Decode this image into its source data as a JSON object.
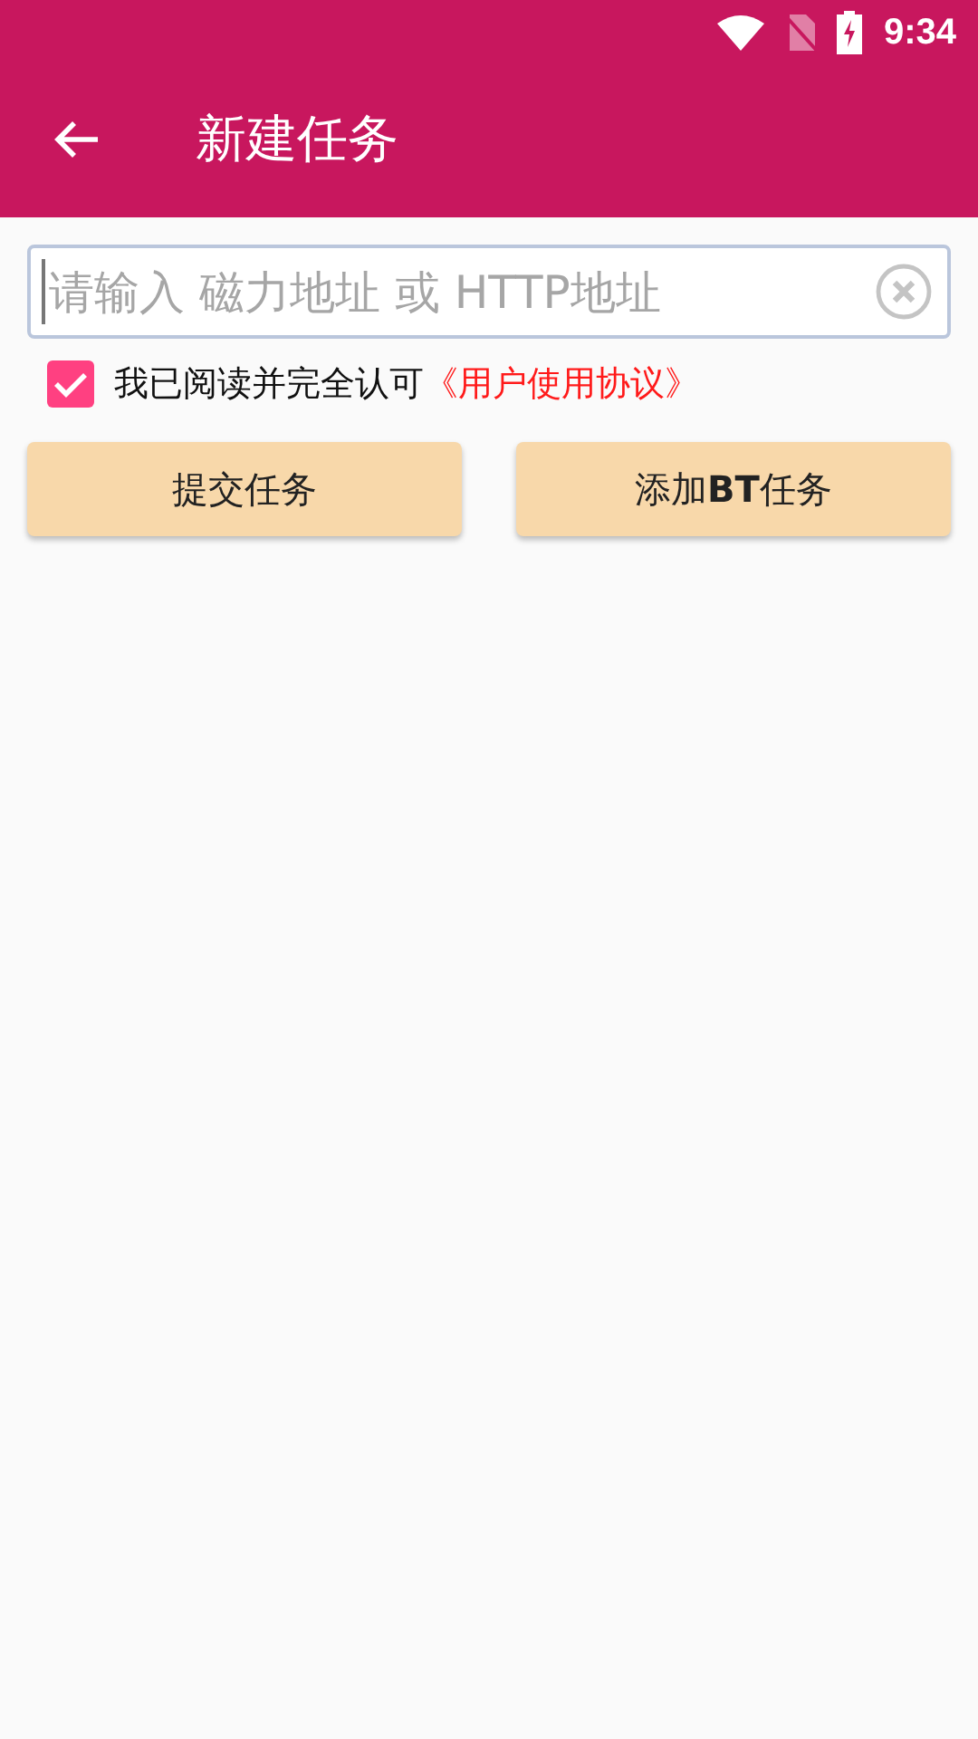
{
  "status_bar": {
    "time": "9:34"
  },
  "toolbar": {
    "title": "新建任务"
  },
  "address_field": {
    "placeholder": "请输入 磁力地址 或 HTTP地址"
  },
  "agreement": {
    "checked": true,
    "text": "我已阅读并完全认可",
    "link": "《用户使用协议》"
  },
  "buttons": [
    {
      "label": "提交任务"
    },
    {
      "label": "添加**BT**任务"
    }
  ]
}
